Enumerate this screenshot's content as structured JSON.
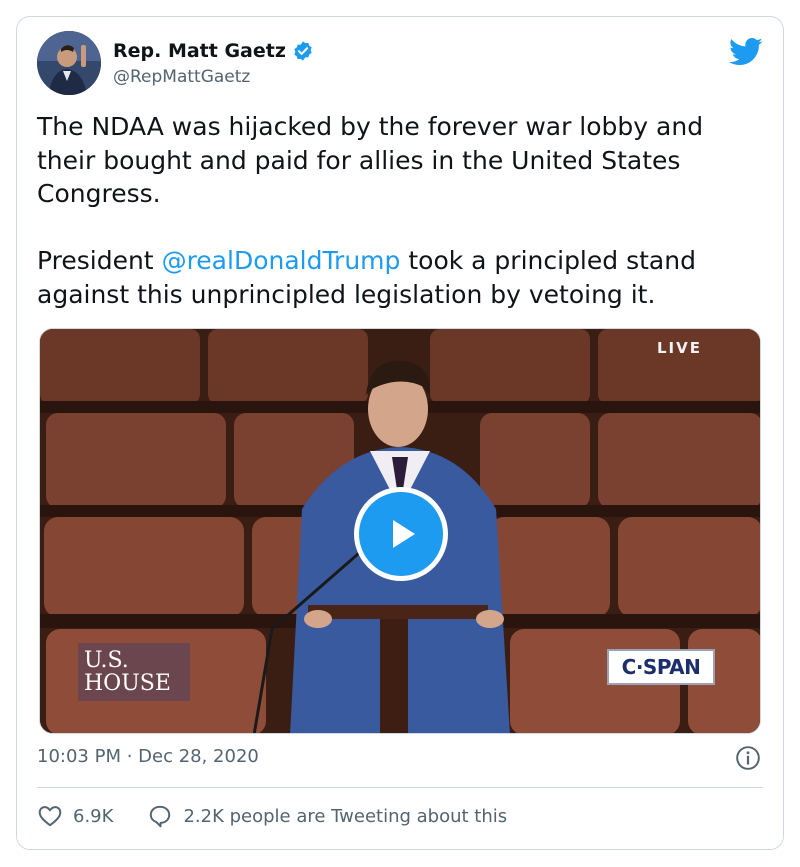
{
  "author": {
    "display_name": "Rep. Matt Gaetz",
    "handle": "@RepMattGaetz",
    "verified": true,
    "avatar_icon": "profile-photo"
  },
  "tweet": {
    "line_1": "The NDAA was hijacked by the forever war lobby and their bought and paid for allies in the United States Congress.",
    "line_2_prefix": "President ",
    "mention": "@realDonaldTrump",
    "line_2_suffix": " took a principled stand against this unprincipled legislation by vetoing it."
  },
  "media": {
    "live_label": "LIVE",
    "house_logo_line1": "U.S.",
    "house_logo_line2": "HOUSE",
    "cspan_logo": "C·SPAN",
    "play_icon": "play-icon"
  },
  "meta": {
    "timestamp": "10:03 PM · Dec 28, 2020"
  },
  "actions": {
    "likes": "6.9K",
    "tweeting_label": "2.2K people are Tweeting about this"
  },
  "colors": {
    "brand": "#1d9bf0",
    "text": "#0f1419",
    "muted": "#536471",
    "border": "#cfd9de"
  }
}
